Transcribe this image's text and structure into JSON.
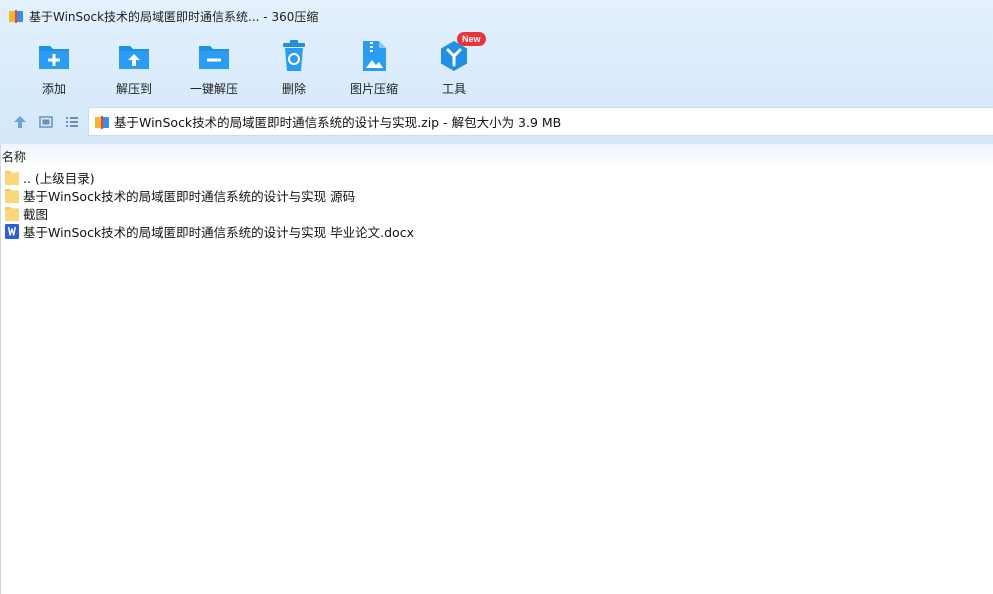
{
  "window": {
    "title": "基于WinSock技术的局域匿即时通信系统... - 360压缩"
  },
  "toolbar": {
    "items": [
      {
        "label": "添加",
        "icon": "add-icon"
      },
      {
        "label": "解压到",
        "icon": "extract-to-icon"
      },
      {
        "label": "一键解压",
        "icon": "one-click-extract-icon"
      },
      {
        "label": "删除",
        "icon": "delete-icon"
      },
      {
        "label": "图片压缩",
        "icon": "image-compress-icon"
      },
      {
        "label": "工具",
        "icon": "tools-icon",
        "badge": "New"
      }
    ]
  },
  "nav": {
    "path": "基于WinSock技术的局域匿即时通信系统的设计与实现.zip - 解包大小为 3.9 MB"
  },
  "list": {
    "column_name": "名称",
    "rows": [
      {
        "name": ".. (上级目录)",
        "type": "folder"
      },
      {
        "name": "基于WinSock技术的局域匿即时通信系统的设计与实现 源码",
        "type": "folder"
      },
      {
        "name": "截图",
        "type": "folder"
      },
      {
        "name": "基于WinSock技术的局域匿即时通信系统的设计与实现 毕业论文.docx",
        "type": "word"
      }
    ]
  },
  "colors": {
    "accent": "#1f8fe8",
    "badge": "#e8343a",
    "folder": "#fad779",
    "word": "#2b5fd9"
  }
}
